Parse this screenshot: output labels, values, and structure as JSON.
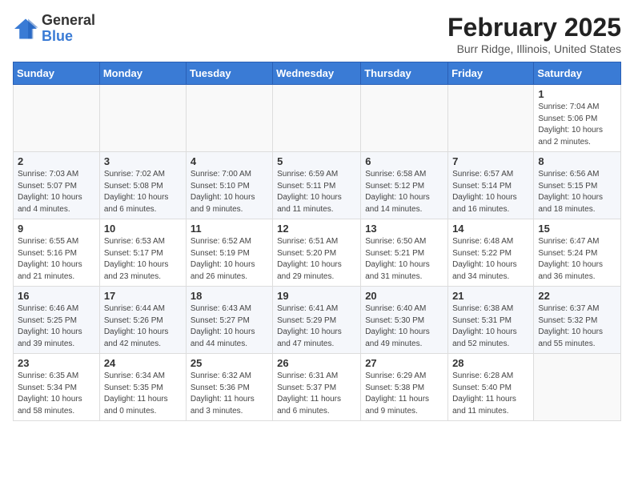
{
  "logo": {
    "general": "General",
    "blue": "Blue"
  },
  "title": "February 2025",
  "subtitle": "Burr Ridge, Illinois, United States",
  "weekdays": [
    "Sunday",
    "Monday",
    "Tuesday",
    "Wednesday",
    "Thursday",
    "Friday",
    "Saturday"
  ],
  "weeks": [
    [
      {
        "day": "",
        "info": ""
      },
      {
        "day": "",
        "info": ""
      },
      {
        "day": "",
        "info": ""
      },
      {
        "day": "",
        "info": ""
      },
      {
        "day": "",
        "info": ""
      },
      {
        "day": "",
        "info": ""
      },
      {
        "day": "1",
        "info": "Sunrise: 7:04 AM\nSunset: 5:06 PM\nDaylight: 10 hours\nand 2 minutes."
      }
    ],
    [
      {
        "day": "2",
        "info": "Sunrise: 7:03 AM\nSunset: 5:07 PM\nDaylight: 10 hours\nand 4 minutes."
      },
      {
        "day": "3",
        "info": "Sunrise: 7:02 AM\nSunset: 5:08 PM\nDaylight: 10 hours\nand 6 minutes."
      },
      {
        "day": "4",
        "info": "Sunrise: 7:00 AM\nSunset: 5:10 PM\nDaylight: 10 hours\nand 9 minutes."
      },
      {
        "day": "5",
        "info": "Sunrise: 6:59 AM\nSunset: 5:11 PM\nDaylight: 10 hours\nand 11 minutes."
      },
      {
        "day": "6",
        "info": "Sunrise: 6:58 AM\nSunset: 5:12 PM\nDaylight: 10 hours\nand 14 minutes."
      },
      {
        "day": "7",
        "info": "Sunrise: 6:57 AM\nSunset: 5:14 PM\nDaylight: 10 hours\nand 16 minutes."
      },
      {
        "day": "8",
        "info": "Sunrise: 6:56 AM\nSunset: 5:15 PM\nDaylight: 10 hours\nand 18 minutes."
      }
    ],
    [
      {
        "day": "9",
        "info": "Sunrise: 6:55 AM\nSunset: 5:16 PM\nDaylight: 10 hours\nand 21 minutes."
      },
      {
        "day": "10",
        "info": "Sunrise: 6:53 AM\nSunset: 5:17 PM\nDaylight: 10 hours\nand 23 minutes."
      },
      {
        "day": "11",
        "info": "Sunrise: 6:52 AM\nSunset: 5:19 PM\nDaylight: 10 hours\nand 26 minutes."
      },
      {
        "day": "12",
        "info": "Sunrise: 6:51 AM\nSunset: 5:20 PM\nDaylight: 10 hours\nand 29 minutes."
      },
      {
        "day": "13",
        "info": "Sunrise: 6:50 AM\nSunset: 5:21 PM\nDaylight: 10 hours\nand 31 minutes."
      },
      {
        "day": "14",
        "info": "Sunrise: 6:48 AM\nSunset: 5:22 PM\nDaylight: 10 hours\nand 34 minutes."
      },
      {
        "day": "15",
        "info": "Sunrise: 6:47 AM\nSunset: 5:24 PM\nDaylight: 10 hours\nand 36 minutes."
      }
    ],
    [
      {
        "day": "16",
        "info": "Sunrise: 6:46 AM\nSunset: 5:25 PM\nDaylight: 10 hours\nand 39 minutes."
      },
      {
        "day": "17",
        "info": "Sunrise: 6:44 AM\nSunset: 5:26 PM\nDaylight: 10 hours\nand 42 minutes."
      },
      {
        "day": "18",
        "info": "Sunrise: 6:43 AM\nSunset: 5:27 PM\nDaylight: 10 hours\nand 44 minutes."
      },
      {
        "day": "19",
        "info": "Sunrise: 6:41 AM\nSunset: 5:29 PM\nDaylight: 10 hours\nand 47 minutes."
      },
      {
        "day": "20",
        "info": "Sunrise: 6:40 AM\nSunset: 5:30 PM\nDaylight: 10 hours\nand 49 minutes."
      },
      {
        "day": "21",
        "info": "Sunrise: 6:38 AM\nSunset: 5:31 PM\nDaylight: 10 hours\nand 52 minutes."
      },
      {
        "day": "22",
        "info": "Sunrise: 6:37 AM\nSunset: 5:32 PM\nDaylight: 10 hours\nand 55 minutes."
      }
    ],
    [
      {
        "day": "23",
        "info": "Sunrise: 6:35 AM\nSunset: 5:34 PM\nDaylight: 10 hours\nand 58 minutes."
      },
      {
        "day": "24",
        "info": "Sunrise: 6:34 AM\nSunset: 5:35 PM\nDaylight: 11 hours\nand 0 minutes."
      },
      {
        "day": "25",
        "info": "Sunrise: 6:32 AM\nSunset: 5:36 PM\nDaylight: 11 hours\nand 3 minutes."
      },
      {
        "day": "26",
        "info": "Sunrise: 6:31 AM\nSunset: 5:37 PM\nDaylight: 11 hours\nand 6 minutes."
      },
      {
        "day": "27",
        "info": "Sunrise: 6:29 AM\nSunset: 5:38 PM\nDaylight: 11 hours\nand 9 minutes."
      },
      {
        "day": "28",
        "info": "Sunrise: 6:28 AM\nSunset: 5:40 PM\nDaylight: 11 hours\nand 11 minutes."
      },
      {
        "day": "",
        "info": ""
      }
    ]
  ]
}
